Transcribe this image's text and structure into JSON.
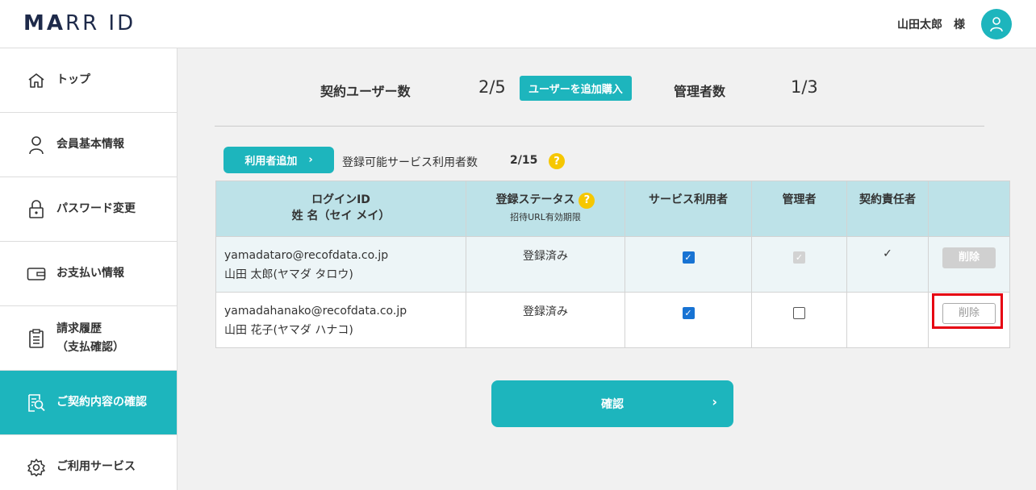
{
  "header": {
    "logo_bold": "MA",
    "logo_rest": "RR ID",
    "user_name": "山田太郎　様"
  },
  "sidebar": {
    "items": [
      {
        "label": "トップ"
      },
      {
        "label": "会員基本情報"
      },
      {
        "label": "パスワード変更"
      },
      {
        "label": "お支払い情報"
      },
      {
        "label": "請求履歴",
        "label2": "（支払確認）"
      },
      {
        "label": "ご契約内容の確認"
      },
      {
        "label": "ご利用サービス"
      }
    ]
  },
  "summary": {
    "contract_users_label": "契約ユーザー数",
    "contract_users_value": "2/5",
    "add_purchase_button": "ユーザーを追加購入",
    "admins_label": "管理者数",
    "admins_value": "1/3"
  },
  "users": {
    "add_button": "利用者追加",
    "registrable_label": "登録可能サービス利用者数",
    "registrable_value": "2/15",
    "help": "?"
  },
  "table": {
    "headers": {
      "login_id": "ログインID",
      "name": "姓 名（セイ メイ）",
      "status": "登録ステータス",
      "status_sub": "招待URL有効期限",
      "service_user": "サービス利用者",
      "admin": "管理者",
      "contract_owner": "契約責任者"
    },
    "rows": [
      {
        "email": "yamadataro@recofdata.co.jp",
        "name": "山田 太郎(ヤマダ タロウ)",
        "status": "登録済み",
        "service_user": true,
        "admin": true,
        "contract_owner_mark": "✓",
        "delete_label": "削除"
      },
      {
        "email": "yamadahanako@recofdata.co.jp",
        "name": "山田 花子(ヤマダ ハナコ)",
        "status": "登録済み",
        "service_user": true,
        "admin": false,
        "contract_owner_mark": "",
        "delete_label": "削除"
      }
    ]
  },
  "confirm_button": "確認",
  "colors": {
    "accent": "#1db5bd",
    "table_header": "#bde2e8",
    "highlight": "#e60012",
    "help": "#f6c700"
  }
}
